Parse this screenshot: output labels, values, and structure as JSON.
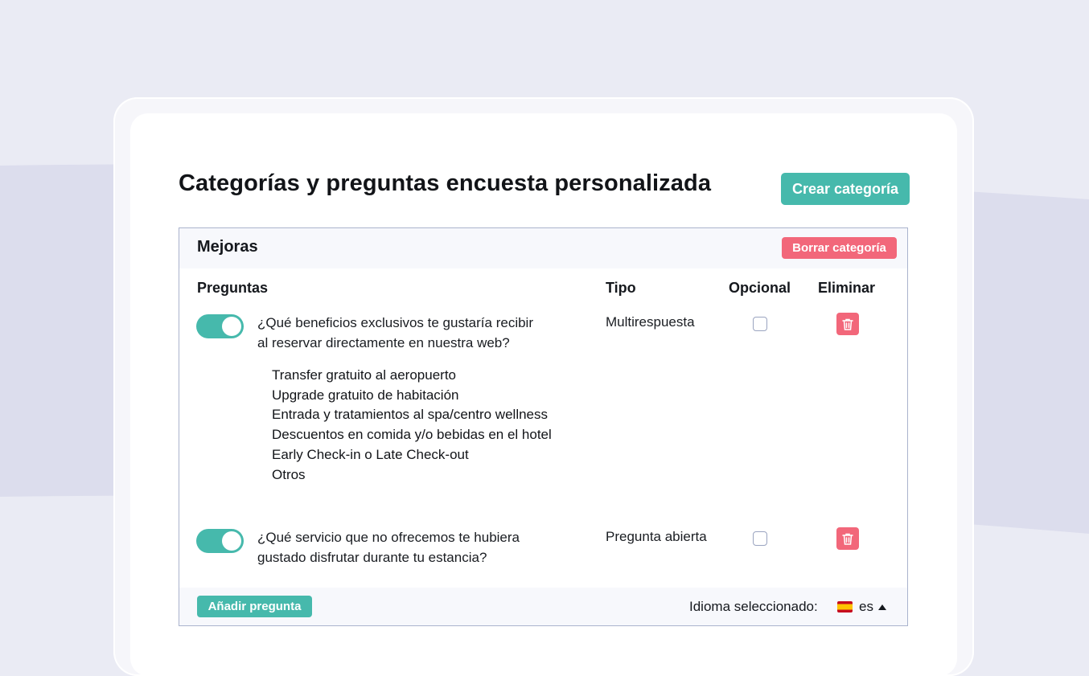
{
  "page": {
    "title": "Categorías y preguntas encuesta personalizada",
    "create_category_label": "Crear categoría"
  },
  "category": {
    "name": "Mejoras",
    "delete_label": "Borrar categoría",
    "columns": {
      "questions": "Preguntas",
      "type": "Tipo",
      "optional": "Opcional",
      "delete": "Eliminar"
    },
    "questions": [
      {
        "enabled": true,
        "text_line1": "¿Qué beneficios exclusivos te gustaría recibir",
        "text_line2": "al reservar directamente en nuestra web?",
        "type": "Multirespuesta",
        "optional": false,
        "options": [
          "Transfer gratuito al aeropuerto",
          "Upgrade gratuito de habitación",
          "Entrada y tratamientos al spa/centro wellness",
          "Descuentos en comida y/o bebidas en el hotel",
          "Early Check-in o Late Check-out",
          "Otros"
        ]
      },
      {
        "enabled": true,
        "text_line1": "¿Qué servicio que no ofrecemos te hubiera",
        "text_line2": "gustado disfrutar durante tu estancia?",
        "type": "Pregunta abierta",
        "optional": false
      }
    ],
    "add_question_label": "Añadir pregunta",
    "language_label": "Idioma seleccionado:",
    "language_code": "es"
  },
  "colors": {
    "accent": "#46b9ac",
    "danger": "#f2677a",
    "background": "#eaebf4",
    "band": "#dcdded"
  },
  "icons": {
    "toggle": "toggle-switch",
    "trash": "trash-icon",
    "flag": "spain-flag-icon",
    "caret": "caret-up-icon"
  }
}
